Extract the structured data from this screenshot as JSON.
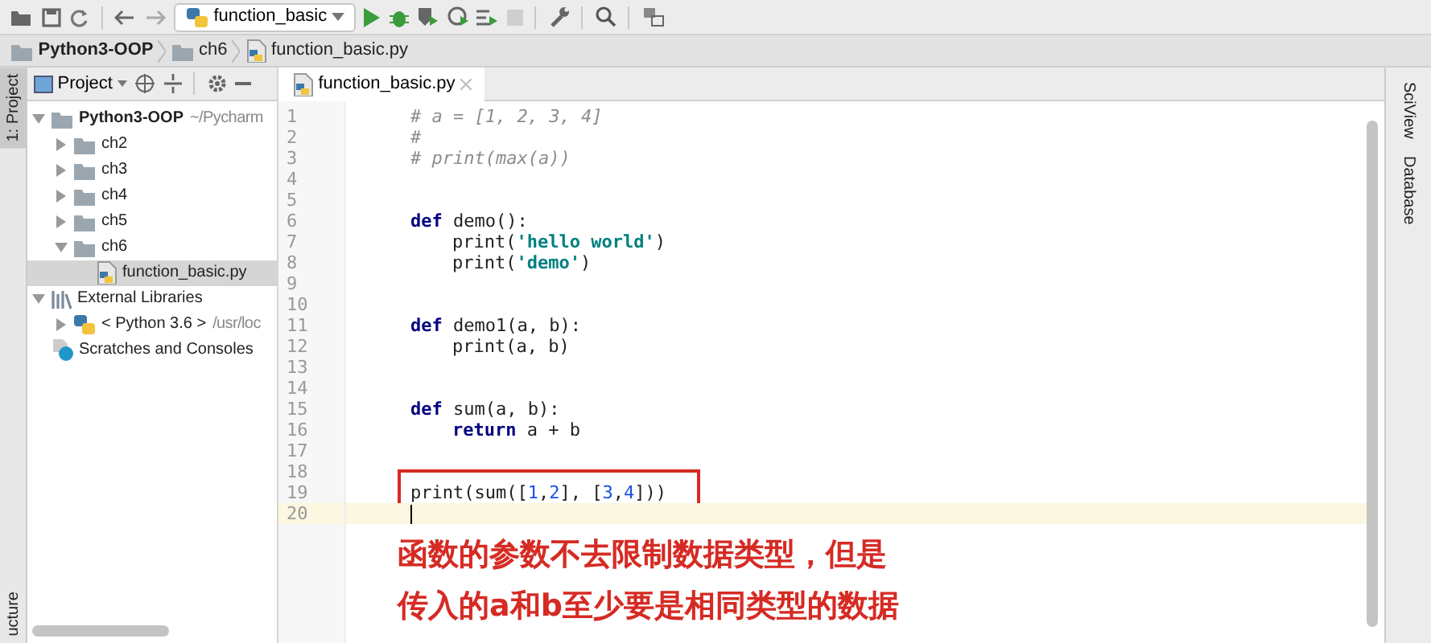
{
  "toolbar": {
    "run_config": "function_basic"
  },
  "breadcrumbs": [
    {
      "label": "Python3-OOP",
      "kind": "project"
    },
    {
      "label": "ch6",
      "kind": "folder"
    },
    {
      "label": "function_basic.py",
      "kind": "file"
    }
  ],
  "left_strip": {
    "top_tab": "1: Project",
    "bottom_tab": "ucture"
  },
  "project_panel": {
    "title": "Project",
    "tree": [
      {
        "label": "Python3-OOP",
        "detail": "~/Pycharm",
        "kind": "project",
        "expanded": true,
        "selected": false,
        "children": [
          {
            "label": "ch2",
            "kind": "folder",
            "expanded": false,
            "selected": false
          },
          {
            "label": "ch3",
            "kind": "folder",
            "expanded": false,
            "selected": false
          },
          {
            "label": "ch4",
            "kind": "folder",
            "expanded": false,
            "selected": false
          },
          {
            "label": "ch5",
            "kind": "folder",
            "expanded": false,
            "selected": false
          },
          {
            "label": "ch6",
            "kind": "folder",
            "expanded": true,
            "selected": false,
            "children": [
              {
                "label": "function_basic.py",
                "kind": "file",
                "selected": true
              }
            ]
          }
        ]
      },
      {
        "label": "External Libraries",
        "kind": "library",
        "expanded": true,
        "selected": false,
        "children": [
          {
            "label": "< Python 3.6 >",
            "detail": "/usr/loc",
            "kind": "python",
            "expanded": false,
            "selected": false
          }
        ]
      },
      {
        "label": "Scratches and Consoles",
        "kind": "scratches",
        "selected": false
      }
    ]
  },
  "editor": {
    "tabs": [
      {
        "label": "function_basic.py",
        "selected": true
      }
    ],
    "lines": [
      {
        "number": "1",
        "tokens": [
          {
            "text": "# a = [1, 2, 3, 4]",
            "kind": "comment"
          }
        ]
      },
      {
        "number": "2",
        "tokens": [
          {
            "text": "#",
            "kind": "comment"
          }
        ]
      },
      {
        "number": "3",
        "tokens": [
          {
            "text": "# print(max(a))",
            "kind": "comment"
          }
        ]
      },
      {
        "number": "4"
      },
      {
        "number": "5"
      },
      {
        "number": "6",
        "tokens": [
          {
            "text": "def",
            "kind": "keyword"
          },
          {
            "text": " demo():",
            "kind": "plain"
          }
        ]
      },
      {
        "number": "7",
        "indented": true,
        "tokens": [
          {
            "text": "print(",
            "kind": "plain"
          },
          {
            "text": "'hello world'",
            "kind": "string"
          },
          {
            "text": ")",
            "kind": "plain"
          }
        ]
      },
      {
        "number": "8",
        "indented": true,
        "tokens": [
          {
            "text": "print(",
            "kind": "plain"
          },
          {
            "text": "'demo'",
            "kind": "string"
          },
          {
            "text": ")",
            "kind": "plain"
          }
        ]
      },
      {
        "number": "9"
      },
      {
        "number": "10"
      },
      {
        "number": "11",
        "tokens": [
          {
            "text": "def",
            "kind": "keyword"
          },
          {
            "text": " demo1(a, b):",
            "kind": "plain"
          }
        ]
      },
      {
        "number": "12",
        "indented": true,
        "tokens": [
          {
            "text": "print(a, b)",
            "kind": "plain"
          }
        ]
      },
      {
        "number": "13"
      },
      {
        "number": "14"
      },
      {
        "number": "15",
        "tokens": [
          {
            "text": "def",
            "kind": "keyword"
          },
          {
            "text": " sum(a, b):",
            "kind": "plain"
          }
        ]
      },
      {
        "number": "16",
        "indented": true,
        "tokens": [
          {
            "text": "return",
            "kind": "keyword"
          },
          {
            "text": " a + b",
            "kind": "plain"
          }
        ]
      },
      {
        "number": "17"
      },
      {
        "number": "18"
      },
      {
        "number": "19",
        "boxed": true,
        "tokens": [
          {
            "text": "print(sum([",
            "kind": "plain"
          },
          {
            "text": "1",
            "kind": "number"
          },
          {
            "text": ",",
            "kind": "plain"
          },
          {
            "text": "2",
            "kind": "number"
          },
          {
            "text": "], [",
            "kind": "plain"
          },
          {
            "text": "3",
            "kind": "number"
          },
          {
            "text": ",",
            "kind": "plain"
          },
          {
            "text": "4",
            "kind": "number"
          },
          {
            "text": "]))",
            "kind": "plain"
          }
        ]
      },
      {
        "number": "20",
        "current": true
      }
    ],
    "annotation": [
      "函数的参数不去限制数据类型，但是",
      "传入的a和b至少要是相同类型的数据"
    ]
  },
  "right_strip": {
    "tabs": [
      "SciView",
      "Database"
    ]
  }
}
